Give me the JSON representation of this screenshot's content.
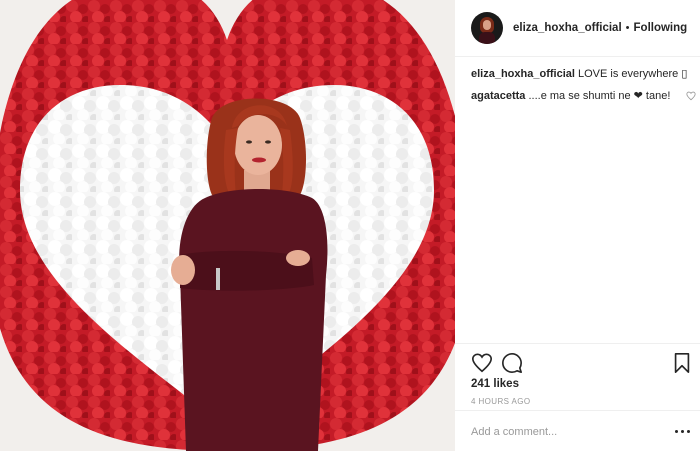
{
  "post": {
    "image": {
      "description_icon": "photo-heart-flowers"
    }
  },
  "header": {
    "username": "eliza_hoxha_official",
    "separator": "•",
    "follow_state": "Following"
  },
  "comments": [
    {
      "user": "eliza_hoxha_official",
      "text": "LOVE is everywhere ▯",
      "has_like": false
    },
    {
      "user": "agatacetta",
      "text": "....e ma se shumti ne ❤ tane!",
      "has_like": true
    }
  ],
  "actions": {
    "likes": "241 likes",
    "time": "4 HOURS AGO"
  },
  "add_comment": {
    "placeholder": "Add a comment..."
  },
  "colors": {
    "heart_red": "#c81e2a",
    "heart_white": "#ffffff",
    "dress": "#5a1420",
    "hair": "#a8381e"
  }
}
